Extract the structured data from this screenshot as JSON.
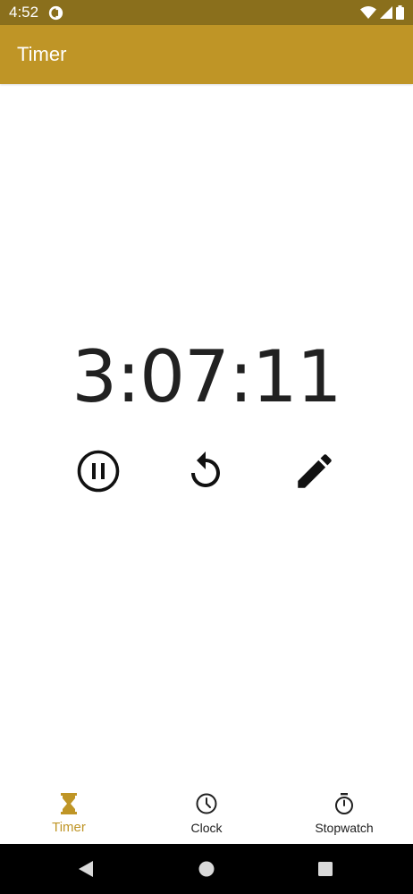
{
  "status_bar": {
    "time": "4:52",
    "background": "#8a6f1c",
    "icons": [
      "app-notification-icon",
      "wifi-icon",
      "cell-signal-icon",
      "battery-icon"
    ]
  },
  "app_bar": {
    "title": "Timer",
    "background": "#bf9526"
  },
  "timer": {
    "display": "3:07:11",
    "controls": [
      {
        "name": "pause",
        "icon": "pause-circle-icon"
      },
      {
        "name": "reset",
        "icon": "replay-icon"
      },
      {
        "name": "edit",
        "icon": "pencil-icon"
      }
    ]
  },
  "bottom_nav": {
    "accent": "#bf9526",
    "items": [
      {
        "label": "Timer",
        "icon": "hourglass-icon",
        "active": true
      },
      {
        "label": "Clock",
        "icon": "clock-icon",
        "active": false
      },
      {
        "label": "Stopwatch",
        "icon": "stopwatch-icon",
        "active": false
      }
    ]
  },
  "system_nav": {
    "buttons": [
      "back-icon",
      "home-icon",
      "recents-icon"
    ]
  }
}
